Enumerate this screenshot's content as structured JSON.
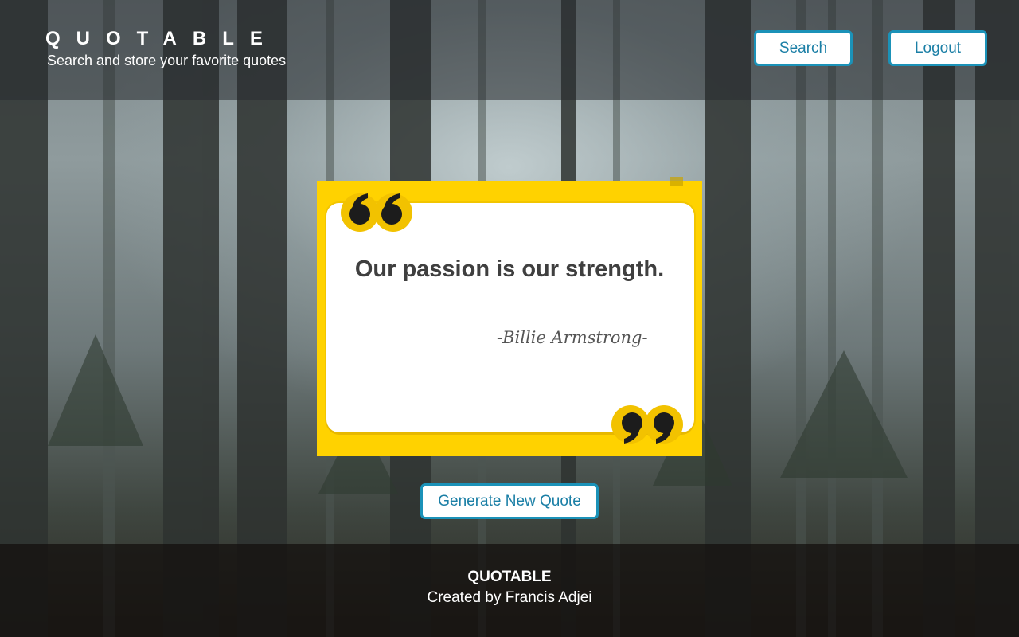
{
  "header": {
    "title": "QUOTABLE",
    "subtitle": "Search and store your favorite quotes",
    "search_label": "Search",
    "logout_label": "Logout"
  },
  "quote_card": {
    "text": "Our passion is our strength.",
    "author": "-Billie Armstrong-",
    "open_icon": "open-quote-icon",
    "close_icon": "close-quote-icon"
  },
  "actions": {
    "generate_label": "Generate New Quote"
  },
  "footer": {
    "title": "QUOTABLE",
    "credit": "Created by Francis Adjei"
  },
  "colors": {
    "accent": "#1b92b8",
    "card_yellow": "#ffd200",
    "header_overlay": "#282c30",
    "footer_overlay": "#120e0c"
  }
}
